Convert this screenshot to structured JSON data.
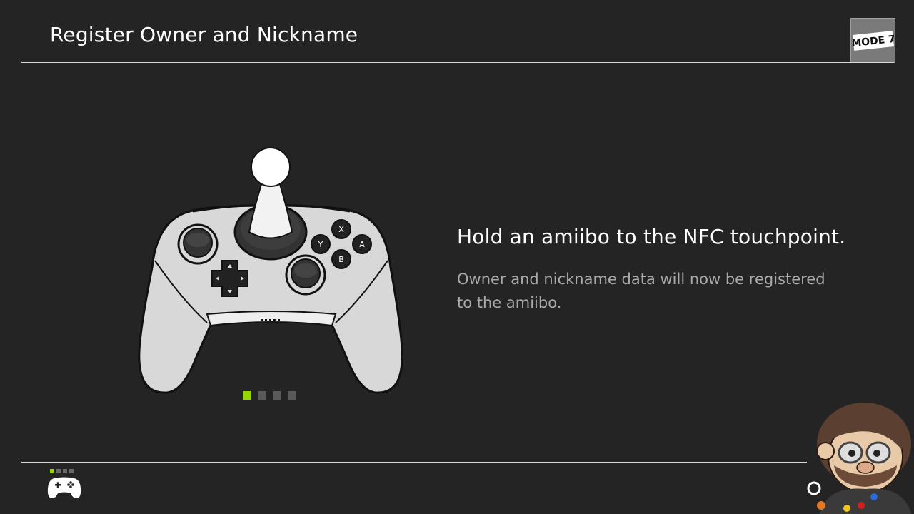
{
  "header": {
    "title": "Register Owner and Nickname",
    "watermark_text": "MODE 7"
  },
  "main": {
    "headline": "Hold an amiibo to the NFC touchpoint.",
    "description": "Owner and nickname data will now be registered to the amiibo.",
    "controller_buttons": [
      "X",
      "Y",
      "A",
      "B"
    ],
    "pager": {
      "total": 4,
      "active_index": 0
    }
  },
  "footer": {
    "controller_icon": "pro-controller-icon",
    "player_indicator": {
      "total": 4,
      "active_index": 0
    }
  },
  "colors": {
    "background": "#242424",
    "accent": "#96d600",
    "text_primary": "#ffffff",
    "text_secondary": "#a9a9a9"
  }
}
